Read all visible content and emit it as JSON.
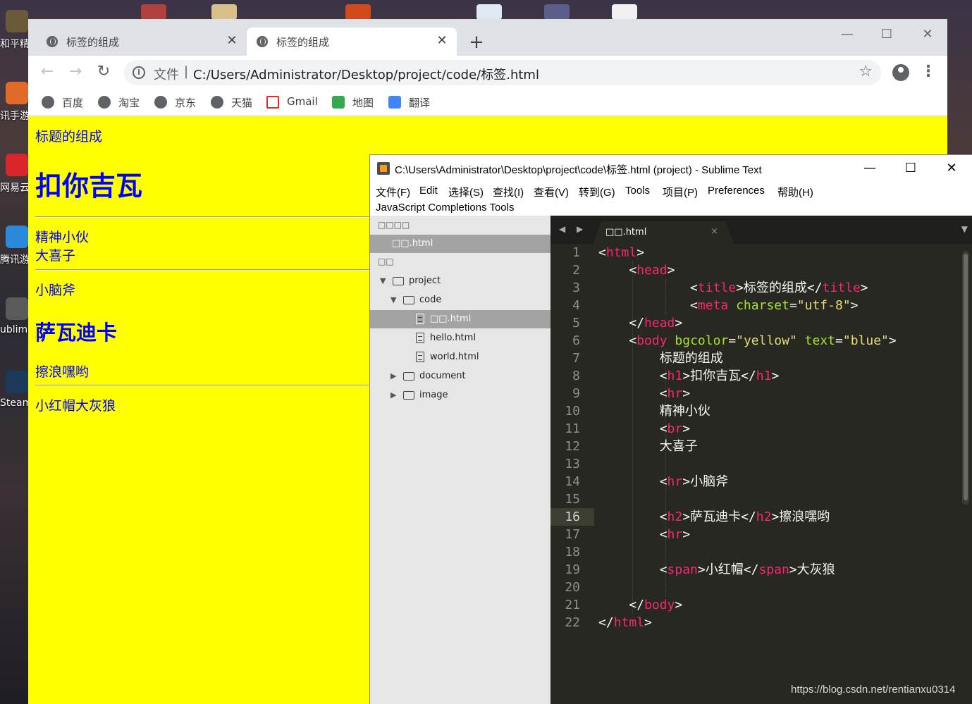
{
  "desktop": {
    "icons": [
      {
        "label": "和平精"
      },
      {
        "label": "讯手游"
      },
      {
        "label": "网易云"
      },
      {
        "label": "腾讯游"
      },
      {
        "label": "ublime"
      },
      {
        "label": "Steam"
      }
    ]
  },
  "chrome": {
    "tabs": [
      {
        "title": "标签的组成",
        "close": "✕"
      },
      {
        "title": "标签的组成",
        "close": "✕"
      }
    ],
    "new_tab": "+",
    "window_controls": {
      "minimize": "—",
      "maximize": "☐",
      "close": "✕"
    },
    "nav": {
      "back": "←",
      "forward": "→",
      "reload": "↻"
    },
    "omnibox": {
      "info": "i",
      "scheme": "文件",
      "separator": "|",
      "url": "C:/Users/Administrator/Desktop/project/code/标签.html",
      "bookmark_star": "☆"
    },
    "menu": "⋮",
    "bookmarks": [
      {
        "label": "百度",
        "icon": "globe-icon"
      },
      {
        "label": "淘宝",
        "icon": "globe-icon"
      },
      {
        "label": "京东",
        "icon": "globe-icon"
      },
      {
        "label": "天猫",
        "icon": "globe-icon"
      },
      {
        "label": "Gmail",
        "icon": "gmail-icon"
      },
      {
        "label": "地图",
        "icon": "maps-icon"
      },
      {
        "label": "翻译",
        "icon": "translate-icon"
      }
    ],
    "page": {
      "background": "#ffff00",
      "text_color": "#0000ff",
      "line1": "标题的组成",
      "h1": "扣你吉瓦",
      "line2a": "精神小伙",
      "line2b": "大喜子",
      "line3": "小脑斧",
      "h2": "萨瓦迪卡",
      "line4": "擦浪嘿哟",
      "line5": "小红帽大灰狼"
    }
  },
  "sublime": {
    "title": "C:\\Users\\Administrator\\Desktop\\project\\code\\标签.html (project) - Sublime Text",
    "window_controls": {
      "minimize": "—",
      "maximize": "☐",
      "close": "✕"
    },
    "menu": [
      "文件(F)",
      "Edit",
      "选择(S)",
      "查找(I)",
      "查看(V)",
      "转到(G)",
      "Tools",
      "项目(P)",
      "Preferences",
      "帮助(H)"
    ],
    "menu2": "JavaScript Completions Tools",
    "sidebar": {
      "open_files_header": "□□□□",
      "open_file": "□□.html",
      "folders_header": "□□",
      "tree": [
        {
          "label": "project",
          "kind": "folder-open"
        },
        {
          "label": "code",
          "kind": "folder-open"
        },
        {
          "label": "□□.html",
          "kind": "file",
          "selected": true
        },
        {
          "label": "hello.html",
          "kind": "file"
        },
        {
          "label": "world.html",
          "kind": "file"
        },
        {
          "label": "document",
          "kind": "folder"
        },
        {
          "label": "image",
          "kind": "folder"
        }
      ]
    },
    "tab": {
      "name": "□□.html",
      "close": "×"
    },
    "nav_arrows": "◀ ▶",
    "tab_menu": "▼",
    "current_line": 16,
    "line_numbers": [
      "1",
      "2",
      "3",
      "4",
      "5",
      "6",
      "7",
      "8",
      "9",
      "10",
      "11",
      "12",
      "13",
      "14",
      "15",
      "16",
      "17",
      "18",
      "19",
      "20",
      "21",
      "22"
    ]
  },
  "watermark": "https://blog.csdn.net/rentianxu0314"
}
